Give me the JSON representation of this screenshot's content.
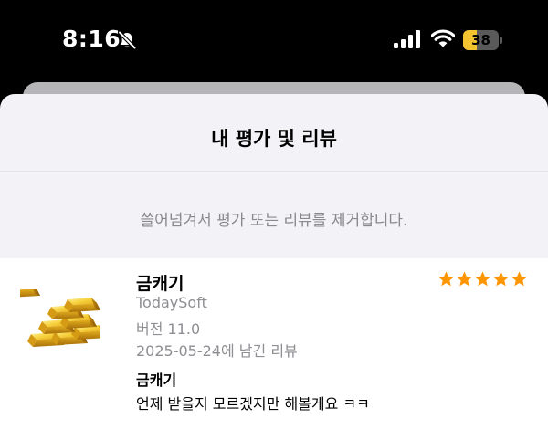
{
  "status_bar": {
    "time": "8:16",
    "battery_level": "38",
    "battery_fraction": 0.38,
    "battery_color": "#f4c430",
    "icons": [
      "bell-muted-icon",
      "cellular-signal-icon",
      "wifi-icon",
      "battery-icon"
    ]
  },
  "sheet": {
    "title": "내 평가 및 리뷰",
    "hint": "쓸어넘겨서 평가 또는 리뷰를 제거합니다."
  },
  "review": {
    "app_icon": "gold-bars-icon",
    "app_name": "금캐기",
    "developer": "TodaySoft",
    "version": "버전 11.0",
    "date": "2025-05-24에 남긴 리뷰",
    "rating": 5,
    "rating_max": 5,
    "star_color": "#ff9500",
    "title": "금캐기",
    "body": "언제 받을지 모르겠지만 해볼게요 ㅋㅋ"
  }
}
